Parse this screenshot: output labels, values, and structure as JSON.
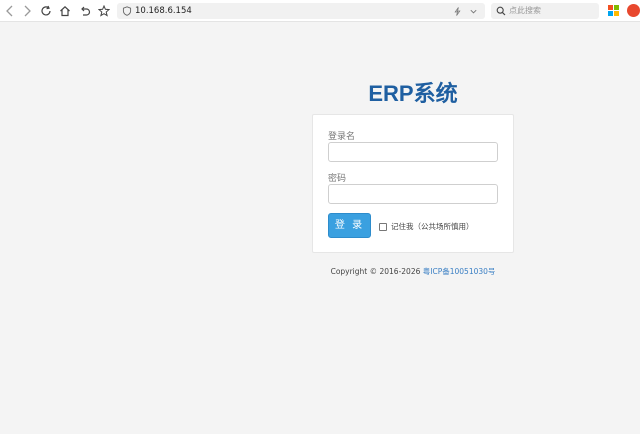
{
  "browser": {
    "url": "10.168.6.154",
    "search_placeholder": "点此搜索",
    "icons": [
      "back-icon",
      "forward-icon",
      "reload-icon",
      "home-icon",
      "undo-icon",
      "favorite-star-icon",
      "shield-icon",
      "lightning-icon",
      "chevron-down-icon",
      "search-icon",
      "microsoft-icon",
      "extension-icon"
    ],
    "colors": {
      "ms_red": "#f25022",
      "ms_green": "#7fba00",
      "ms_blue": "#00a4ef",
      "ms_yellow": "#ffb900",
      "extension": "#e8482e"
    }
  },
  "page": {
    "title": "ERP系统",
    "login": {
      "username_label": "登录名",
      "username_value": "",
      "password_label": "密码",
      "password_value": "",
      "submit_label": "登 录",
      "remember_label": "记住我（公共场所慎用）"
    },
    "footer": {
      "copyright": "Copyright © 2016-2026 ",
      "icp": "粤ICP备10051030号"
    }
  },
  "colors": {
    "title": "#1f5fa1",
    "button": "#3aa0e0",
    "link": "#3a7fc4",
    "background": "#f4f4f4"
  }
}
